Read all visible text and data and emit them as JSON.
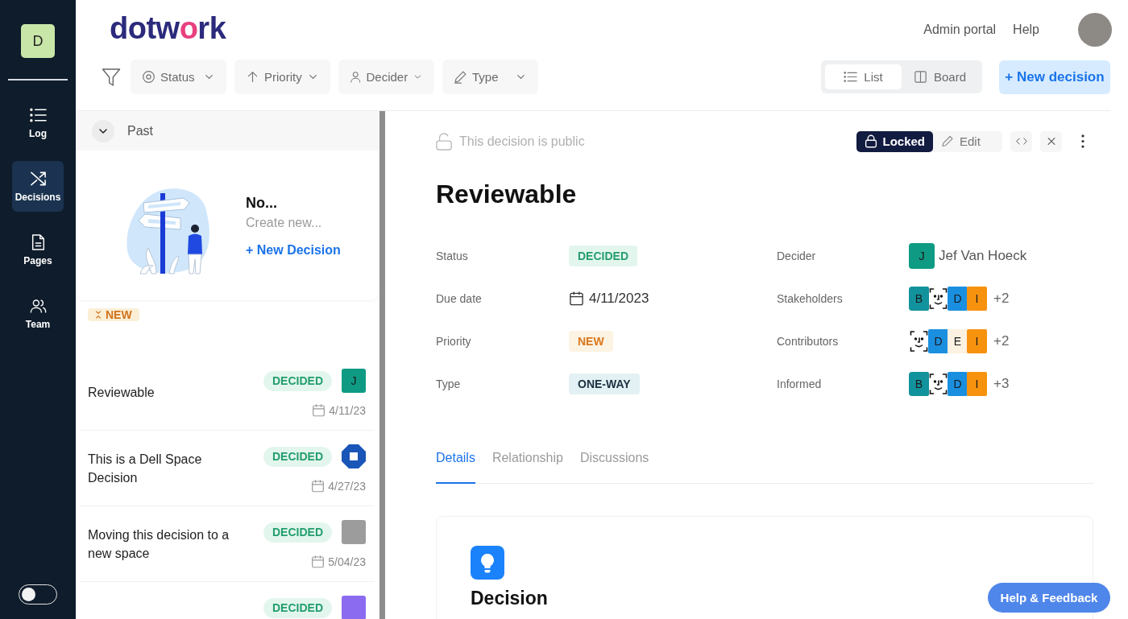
{
  "sidebar": {
    "workspace": "D",
    "items": [
      {
        "label": "Log",
        "selected": false
      },
      {
        "label": "Decisions",
        "selected": true
      },
      {
        "label": "Pages",
        "selected": false
      },
      {
        "label": "Team",
        "selected": false
      }
    ],
    "theme_toggle": {
      "on": false
    }
  },
  "header": {
    "logo": "dotwork",
    "links": [
      "Admin portal",
      "Help"
    ],
    "filters": [
      {
        "label": "Status"
      },
      {
        "label": "Priority"
      },
      {
        "label": "Decider"
      },
      {
        "label": "Type"
      }
    ],
    "views": [
      {
        "label": "List",
        "selected": true
      },
      {
        "label": "Board",
        "selected": false
      }
    ],
    "new_button": "+ New decision"
  },
  "list": {
    "group": {
      "label": "Past",
      "expanded": true
    },
    "empty_state": {
      "title": "No...",
      "subtitle": "Create new...",
      "action": "+ New Decision"
    },
    "priority_tag": "NEW",
    "items": [
      {
        "title": "Reviewable",
        "status": "DECIDED",
        "date": "4/11/23",
        "avatar": {
          "kind": "initial",
          "initial": "J",
          "color": "#0f9b83"
        }
      },
      {
        "title": "This is a Dell Space Decision",
        "status": "DECIDED",
        "date": "4/27/23",
        "avatar": {
          "kind": "logo"
        }
      },
      {
        "title": "Moving this decision to a new space",
        "status": "DECIDED",
        "date": "5/04/23",
        "avatar": {
          "kind": "photo",
          "color": "#9c9c9c"
        }
      },
      {
        "status": "DECIDED",
        "avatar": {
          "kind": "photo",
          "color": "#8b6cf0"
        }
      }
    ]
  },
  "detail": {
    "visibility": "This decision is public",
    "lock_button": "Locked",
    "edit_button": "Edit",
    "title": "Reviewable",
    "properties": [
      {
        "label": "Status",
        "kind": "status",
        "value": "DECIDED"
      },
      {
        "label": "Decider",
        "kind": "person",
        "avatar": {
          "kind": "initial",
          "initial": "J",
          "color": "#0f9b83"
        },
        "value": "Jef Van Hoeck"
      },
      {
        "label": "Due date",
        "kind": "date",
        "value": "4/11/2023"
      },
      {
        "label": "Stakeholders",
        "kind": "people",
        "avatars": [
          {
            "kind": "initial",
            "initial": "B",
            "color": "#12929c"
          },
          {
            "kind": "placeholder"
          },
          {
            "kind": "initial",
            "initial": "D",
            "color": "#1a8fe0"
          },
          {
            "kind": "initial",
            "initial": "I",
            "color": "#f7920f"
          }
        ],
        "value": "+2"
      },
      {
        "label": "Priority",
        "kind": "priority",
        "value": "NEW"
      },
      {
        "label": "Contributors",
        "kind": "people",
        "avatars": [
          {
            "kind": "placeholder"
          },
          {
            "kind": "initial",
            "initial": "D",
            "color": "#1a8fe0"
          },
          {
            "kind": "initial",
            "initial": "E",
            "color": "#fdf1e1"
          },
          {
            "kind": "initial",
            "initial": "I",
            "color": "#f7920f"
          }
        ],
        "value": "+2"
      },
      {
        "label": "Type",
        "kind": "type",
        "value": "ONE-WAY"
      },
      {
        "label": "Informed",
        "kind": "people",
        "avatars": [
          {
            "kind": "initial",
            "initial": "B",
            "color": "#12929c"
          },
          {
            "kind": "placeholder"
          },
          {
            "kind": "initial",
            "initial": "D",
            "color": "#1a8fe0"
          },
          {
            "kind": "initial",
            "initial": "I",
            "color": "#f7920f"
          }
        ],
        "value": "+3"
      }
    ],
    "tabs": [
      {
        "label": "Details",
        "selected": true
      },
      {
        "label": "Relationship",
        "selected": false
      },
      {
        "label": "Discussions",
        "selected": false
      }
    ],
    "section": {
      "title": "Decision"
    }
  },
  "help_button": "Help & Feedback"
}
